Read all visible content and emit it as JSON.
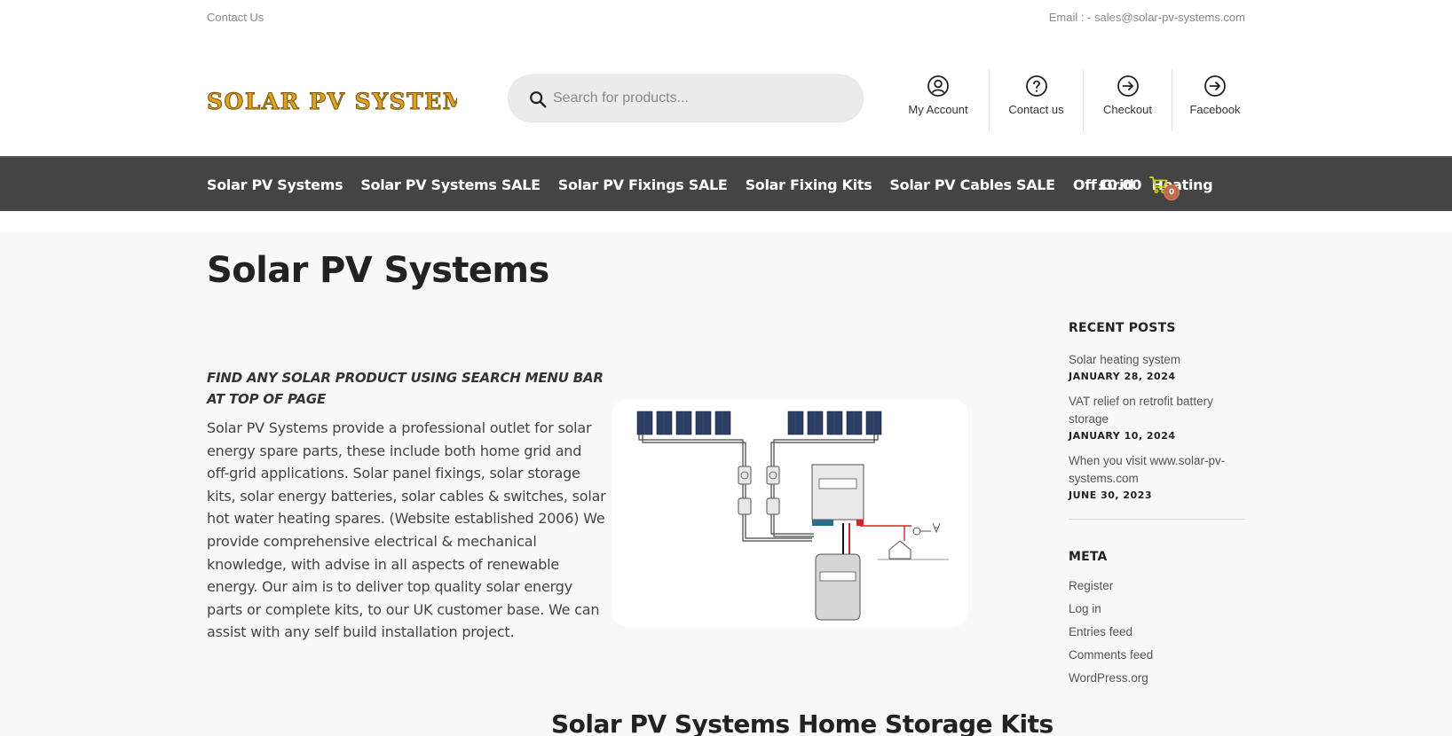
{
  "topbar": {
    "contact_label": "Contact Us",
    "email_label": "Email : - sales@solar-pv-systems.com"
  },
  "header": {
    "logo_text": "SOLAR PV SYSTEMS",
    "search_placeholder": "Search for products...",
    "links": [
      {
        "label": "My Account",
        "icon": "user-circle-icon"
      },
      {
        "label": "Contact us",
        "icon": "question-circle-icon"
      },
      {
        "label": "Checkout",
        "icon": "arrow-circle-icon"
      },
      {
        "label": "Facebook",
        "icon": "arrow-circle-icon"
      }
    ]
  },
  "nav": {
    "items": [
      "Solar PV Systems",
      "Solar PV Systems SALE",
      "Solar PV Fixings SALE",
      "Solar Fixing Kits",
      "Solar PV Cables SALE",
      "Off Grid",
      "Heating"
    ],
    "cart_amount": "£0.00",
    "cart_count": "0"
  },
  "colors": {
    "nav_bg": "#444444",
    "logo_fill": "#e0a21c",
    "cart_icon": "#d4d400",
    "badge": "#c0694d"
  },
  "main": {
    "page_title": "Solar PV Systems",
    "tagline": "FIND ANY SOLAR PRODUCT USING SEARCH MENU BAR AT TOP OF PAGE",
    "intro": "Solar PV Systems provide a professional outlet for solar energy spare parts, these include both home grid and off-grid applications. Solar panel fixings, solar storage kits, solar energy batteries, solar cables & switches, solar hot water heating spares. (Website established 2006) We provide comprehensive electrical & mechanical knowledge, with advise in all aspects of renewable energy. Our aim is to deliver top quality solar energy parts or complete kits, to our UK customer base. We can assist with any self build installation project.",
    "section_title": "Solar PV Systems Home Storage Kits"
  },
  "sidebar": {
    "recent_heading": "RECENT POSTS",
    "posts": [
      {
        "title": "Solar heating system",
        "date": "JANUARY 28, 2024"
      },
      {
        "title": "VAT relief on retrofit battery storage",
        "date": "JANUARY 10, 2024"
      },
      {
        "title": "When you visit www.solar-pv-systems.com",
        "date": "JUNE 30, 2023"
      }
    ],
    "meta_heading": "META",
    "meta_links": [
      "Register",
      "Log in",
      "Entries feed",
      "Comments feed",
      "WordPress.org"
    ]
  }
}
